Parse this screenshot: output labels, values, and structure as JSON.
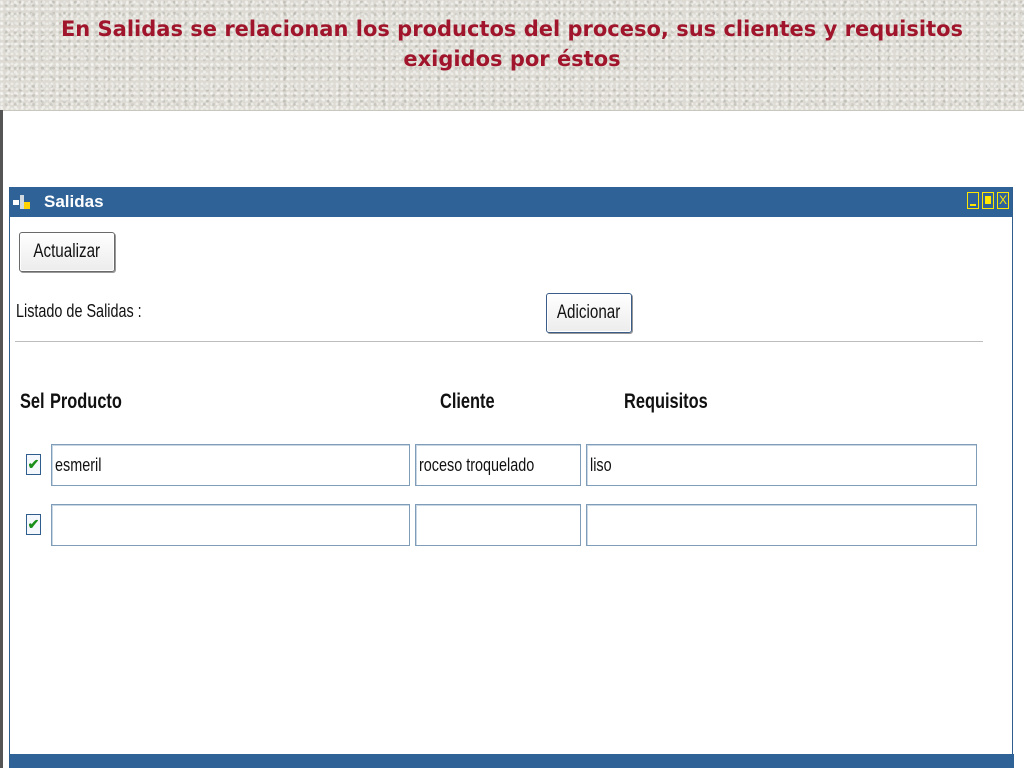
{
  "slide": {
    "title": "En Salidas se relacionan los productos del proceso, sus clientes y requisitos exigidos por éstos"
  },
  "window": {
    "title": "Salidas",
    "close_glyph": "X"
  },
  "toolbar": {
    "refresh_label": "Actualizar",
    "list_label": "Listado de Salidas :",
    "add_label": "Adicionar"
  },
  "table": {
    "headers": {
      "sel": "Sel",
      "producto": "Producto",
      "cliente": "Cliente",
      "requisitos": "Requisitos"
    },
    "rows": [
      {
        "checked": "✔",
        "producto": "esmeril",
        "cliente": "roceso troquelado",
        "requisitos": "liso"
      },
      {
        "checked": "✔",
        "producto": "",
        "cliente": "",
        "requisitos": ""
      }
    ]
  },
  "colors": {
    "title_red": "#a0152b",
    "titlebar_blue": "#2f6297",
    "control_yellow": "#ffe600",
    "check_green": "#1a8f1a"
  },
  "icons": [
    "app-icon",
    "minimize-icon",
    "maximize-icon",
    "close-icon",
    "checkbox-checked-icon"
  ]
}
